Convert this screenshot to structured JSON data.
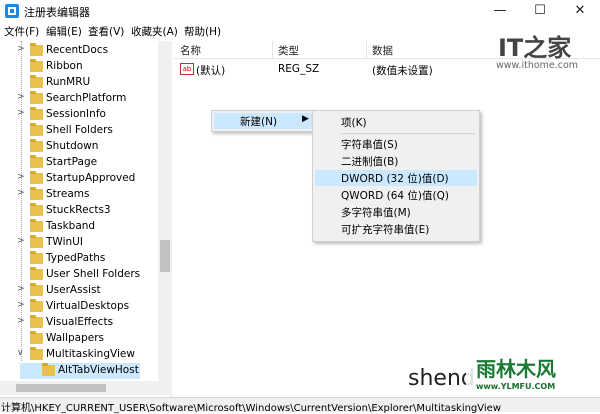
{
  "window": {
    "title": "注册表编辑器",
    "minimize": "—",
    "maximize": "☐",
    "close": "✕"
  },
  "menu": [
    "文件(F)",
    "编辑(E)",
    "查看(V)",
    "收藏夹(A)",
    "帮助(H)"
  ],
  "tree": {
    "items": [
      {
        "label": "RecentDocs",
        "expandable": true
      },
      {
        "label": "Ribbon",
        "expandable": false
      },
      {
        "label": "RunMRU",
        "expandable": false
      },
      {
        "label": "SearchPlatform",
        "expandable": true
      },
      {
        "label": "SessionInfo",
        "expandable": true
      },
      {
        "label": "Shell Folders",
        "expandable": false
      },
      {
        "label": "Shutdown",
        "expandable": false
      },
      {
        "label": "StartPage",
        "expandable": false
      },
      {
        "label": "StartupApproved",
        "expandable": true
      },
      {
        "label": "Streams",
        "expandable": true
      },
      {
        "label": "StuckRects3",
        "expandable": false
      },
      {
        "label": "Taskband",
        "expandable": false
      },
      {
        "label": "TWinUI",
        "expandable": true
      },
      {
        "label": "TypedPaths",
        "expandable": false
      },
      {
        "label": "User Shell Folders",
        "expandable": false
      },
      {
        "label": "UserAssist",
        "expandable": true
      },
      {
        "label": "VirtualDesktops",
        "expandable": true
      },
      {
        "label": "VisualEffects",
        "expandable": true
      },
      {
        "label": "Wallpapers",
        "expandable": false
      },
      {
        "label": "MultitaskingView",
        "expandable": true,
        "expanded": true
      },
      {
        "label": "AltTabViewHost",
        "expandable": false,
        "selected": true,
        "child": true
      }
    ]
  },
  "list": {
    "headers": {
      "name": "名称",
      "type": "类型",
      "data": "数据"
    },
    "rows": [
      {
        "icon": "ab",
        "name": "(默认)",
        "type": "REG_SZ",
        "data": "(数值未设置)"
      }
    ]
  },
  "context_menu": {
    "new_label": "新建(N)",
    "submenu_arrow": "▶",
    "submenu": {
      "key": "项(K)",
      "string": "字符串值(S)",
      "binary": "二进制值(B)",
      "dword": "DWORD (32 位)值(D)",
      "qword": "QWORD (64 位)值(Q)",
      "multi": "多字符串值(M)",
      "expand": "可扩充字符串值(E)"
    }
  },
  "status": {
    "path": "计算机\\HKEY_CURRENT_USER\\Software\\Microsoft\\Windows\\CurrentVersion\\Explorer\\MultitaskingView"
  },
  "watermarks": {
    "it_logo": "IT之家",
    "ithome": "www.ithome.com",
    "shend": "shend",
    "ylmfu_name": "雨林木风",
    "ylmfu_url": "www.YLMFU.COM"
  },
  "colors": {
    "selection": "#cce8ff",
    "folder": "#e8c04a",
    "menu_bg": "#f0f0f0"
  }
}
